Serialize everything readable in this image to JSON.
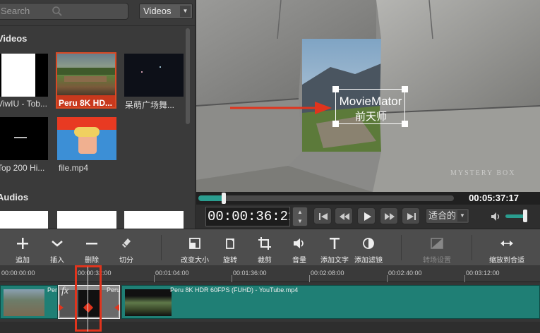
{
  "browser": {
    "search_placeholder": "Search",
    "category": "Videos",
    "section_videos": "Videos",
    "section_audios": "Audios",
    "items": [
      {
        "label": "ViwIU - Tob..."
      },
      {
        "label": "Peru 8K HD..."
      },
      {
        "label": "呆萌广场舞..."
      },
      {
        "label": "Top 200 Hi..."
      },
      {
        "label": "file.mp4"
      }
    ]
  },
  "preview": {
    "overlay_title": "MovieMator",
    "overlay_subtitle": "前天师",
    "watermark": "MYSTERY BOX",
    "progress_fraction": 0.1,
    "duration": "00:05:37:17"
  },
  "controls": {
    "timecode": "00:00:36:21",
    "fit_label": "适合的"
  },
  "toolbar": {
    "add": "追加",
    "insert": "插入",
    "delete": "删除",
    "split": "切分",
    "resize": "改变大小",
    "rotate": "旋转",
    "crop": "裁剪",
    "volume": "音量",
    "add_text": "添加文字",
    "add_filter": "添加滤镜",
    "transition": "转场设置",
    "zoom_fit": "缩放到合适"
  },
  "timeline": {
    "ruler": [
      "00:00:00:00",
      "00:00:32:00",
      "00:01:04:00",
      "00:01:36:00",
      "00:02:08:00",
      "00:02:40:00",
      "00:03:12:00"
    ],
    "clip_short_label": "Peru",
    "clip_fx": "fx",
    "clip_main_label": "Peru 8K HDR 60FPS (FUHD) - YouTube.mp4"
  },
  "colors": {
    "accent": "#2a9d8f",
    "clip": "#1f7f75",
    "highlight": "#e0341d"
  }
}
